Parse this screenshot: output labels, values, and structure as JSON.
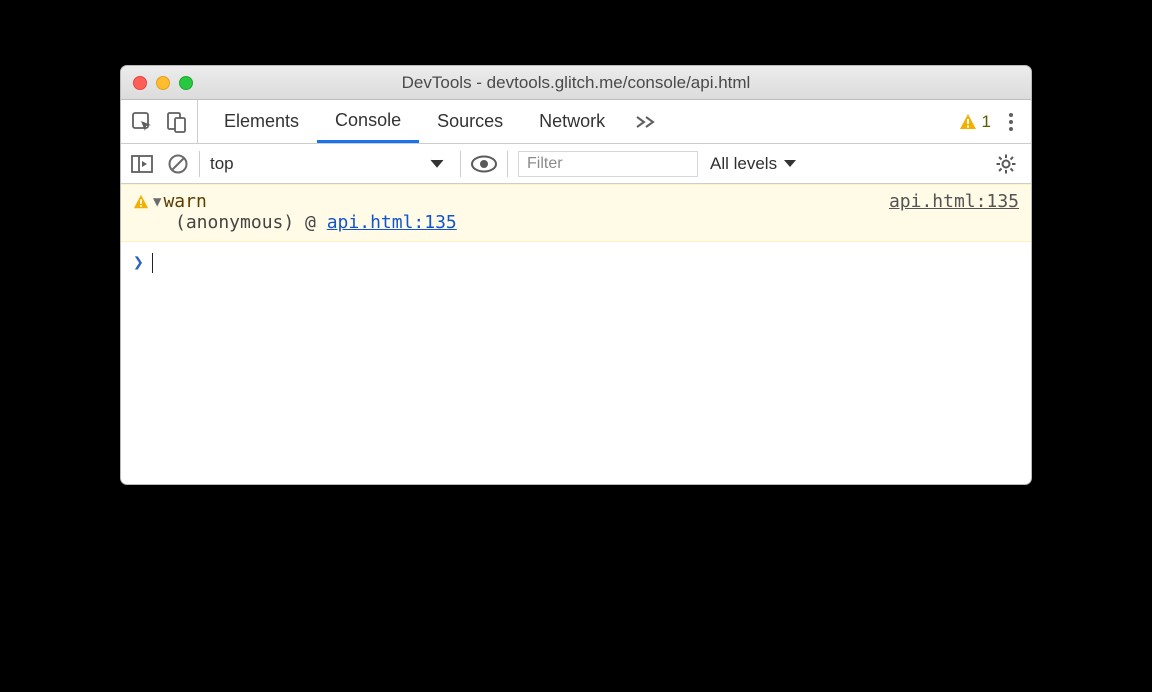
{
  "window": {
    "title": "DevTools - devtools.glitch.me/console/api.html"
  },
  "tabs": {
    "items": [
      "Elements",
      "Console",
      "Sources",
      "Network"
    ],
    "active_index": 1
  },
  "warnings_count": "1",
  "toolbar": {
    "context": "top",
    "filter_placeholder": "Filter",
    "levels_label": "All levels"
  },
  "log": {
    "message": "warn",
    "source_link": "api.html:135",
    "stack_prefix": "(anonymous) @ ",
    "stack_link": "api.html:135"
  }
}
